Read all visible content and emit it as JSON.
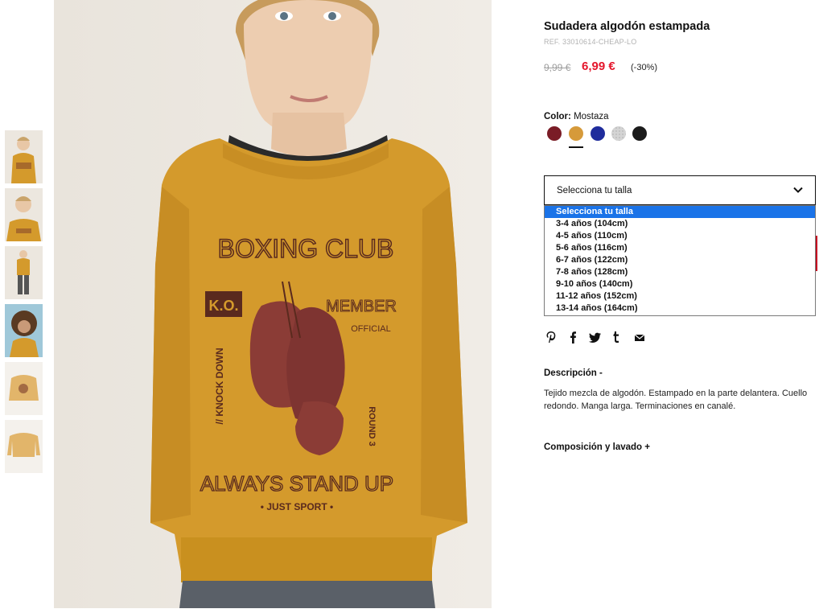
{
  "product": {
    "title": "Sudadera algodón estampada",
    "ref": "REF. 33010614-CHEAP-LO",
    "price_old": "9,99 €",
    "price_new": "6,99 €",
    "discount": "(-30%)"
  },
  "color": {
    "label": "Color:",
    "value": "Mostaza",
    "swatches": [
      {
        "name": "granate",
        "hex": "#7a1c26"
      },
      {
        "name": "mostaza",
        "hex": "#d69a3a",
        "selected": true
      },
      {
        "name": "azul",
        "hex": "#1f2c9c"
      },
      {
        "name": "gris",
        "hex": "#d4d4d4"
      },
      {
        "name": "negro",
        "hex": "#1b1b1b"
      }
    ]
  },
  "size": {
    "selected": "Selecciona tu talla",
    "options": [
      "Selecciona tu talla",
      "3-4 años (104cm)",
      "4-5 años (110cm)",
      "5-6 años (116cm)",
      "6-7 años (122cm)",
      "7-8 años (128cm)",
      "9-10 años (140cm)",
      "11-12 años (152cm)",
      "13-14 años (164cm)"
    ]
  },
  "share": [
    "pinterest-icon",
    "facebook-icon",
    "twitter-icon",
    "tumblr-icon",
    "email-icon"
  ],
  "description": {
    "heading": "Descripción -",
    "text": "Tejido mezcla de algodón. Estampado en la parte delantera. Cuello redondo. Manga larga. Terminaciones en canalé."
  },
  "composition": {
    "heading": "Composición y lavado +"
  },
  "image": {
    "print_line1": "BOXING CLUB",
    "print_ko": "K.O.",
    "print_member": "MEMBER",
    "print_official": "OFFICIAL",
    "print_knock": "// KNOCK DOWN",
    "print_round": "ROUND 3",
    "print_line2": "ALWAYS STAND UP",
    "print_line3": "• JUST SPORT •"
  },
  "colors": {
    "accent_red": "#e4152b",
    "select_blue": "#1a73e8",
    "sweater": "#d49a2c"
  }
}
